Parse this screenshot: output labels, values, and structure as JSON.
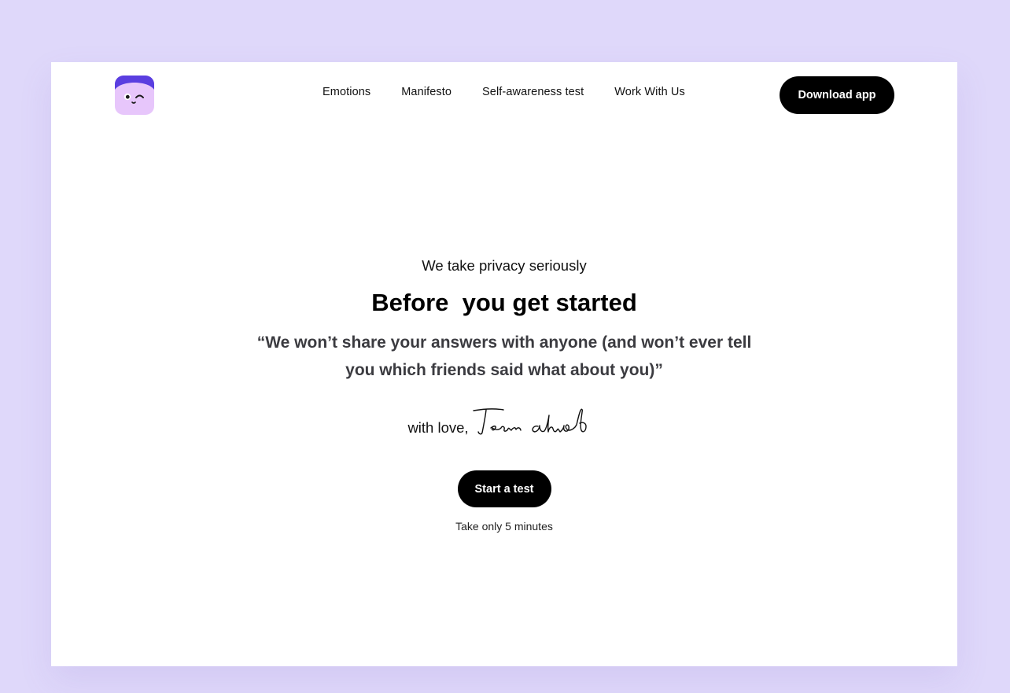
{
  "nav": {
    "items": [
      {
        "label": "Emotions"
      },
      {
        "label": "Manifesto"
      },
      {
        "label": "Self-awareness test"
      },
      {
        "label": "Work With Us"
      }
    ],
    "download_label": "Download app"
  },
  "logo": {
    "icon": "winking-face-logo-icon",
    "colors": {
      "top": "#5a3ee0",
      "face": "#e7c6fb"
    }
  },
  "hero": {
    "eyebrow": "We take privacy seriously",
    "title": "Before  you get started",
    "quote": "“We won’t share your answers with anyone (and won’t ever tell you which friends said what about you)”",
    "signoff": "with love,",
    "signature_text": "Team ahead",
    "cta_label": "Start a test",
    "note": "Take only 5 minutes"
  },
  "colors": {
    "background": "#dfd8fa",
    "card": "#ffffff",
    "button": "#000000",
    "quote_text": "#3b3b40"
  }
}
